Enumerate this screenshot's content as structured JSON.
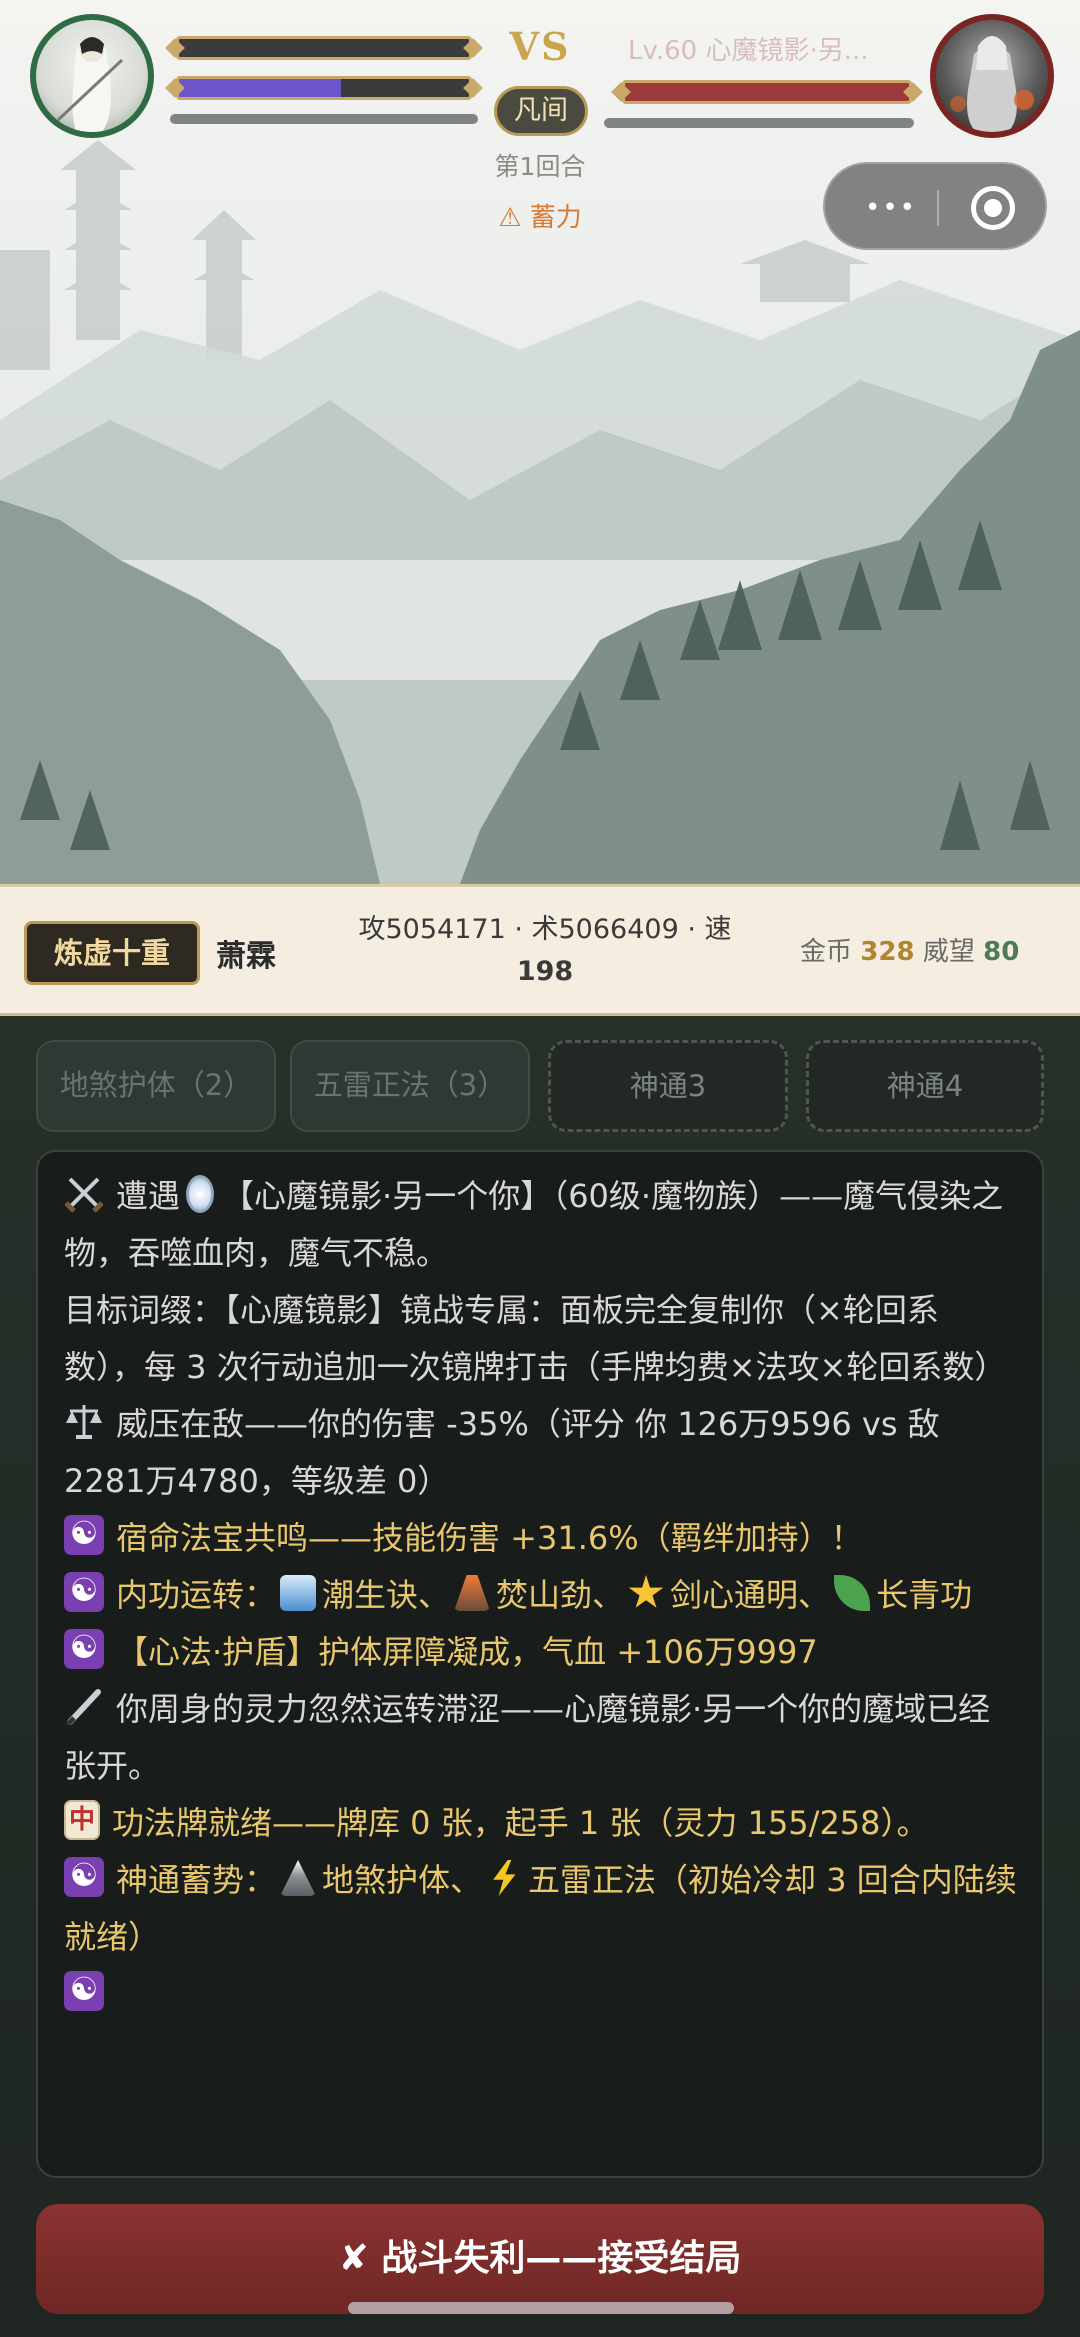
{
  "battle": {
    "vs_label": "VS",
    "realm": "凡间",
    "round": "第1回合",
    "charge_status": "⚠ 蓄力",
    "enemy_name": "Lv.60 心魔镜影·另...",
    "player_mana_fraction": 0.56,
    "enemy_hp_fraction": 1.0
  },
  "capsule": {
    "more": "•••",
    "close_icon": "target-icon"
  },
  "player": {
    "rank": "炼虚十重",
    "name": "萧霖",
    "stats_line1": "攻5054171 · 术5066409 · 速",
    "stats_line2": "198",
    "gold_label": "金币",
    "gold_value": "328",
    "fame_label": "威望",
    "fame_value": "80"
  },
  "skills": [
    {
      "label": "地煞护体（2）",
      "state": "cooldown",
      "icon": "mountain-icon"
    },
    {
      "label": "五雷正法（3）",
      "state": "cooldown",
      "icon": "lightning-icon"
    },
    {
      "label": "神通3",
      "state": "empty"
    },
    {
      "label": "神通4",
      "state": "empty"
    }
  ],
  "log": {
    "l1": "遭遇",
    "l1b": "【心魔镜影·另一个你】（60级·魔物族）——魔气侵染之物，吞噬血肉，魔气不稳。",
    "l2": "目标词缀：【心魔镜影】镜战专属：面板完全复制你（×轮回系数），每 3 次行动追加一次镜牌打击（手牌均费×法攻×轮回系数）",
    "l3": "威压在敌——你的伤害 -35%（评分 你 126万9596 vs 敌 2281万4780，等级差 0）",
    "l4": "宿命法宝共鸣——技能伤害 +31.6%（羁绊加持）！",
    "l5a": "内功运转：",
    "l5b": "潮生诀、",
    "l5c": "焚山劲、",
    "l5d": "剑心通明、",
    "l5e": "长青功",
    "l6": "【心法·护盾】护体屏障凝成，气血 +106万9997",
    "l7": "你周身的灵力忽然运转滞涩——心魔镜影·另一个你的魔域已经张开。",
    "l8": "功法牌就绪——牌库 0 张，起手 1 张（灵力 155/258）。",
    "l9a": "神通蓄势：",
    "l9b": "地煞护体、",
    "l9c": "五雷正法（初始冷却 3 回合内陆续就绪）"
  },
  "footer": {
    "defeat_button": "✘ 战斗失利——接受结局"
  },
  "colors": {
    "accent_gold": "#c9a54e",
    "danger": "#7f2c2a",
    "mana": "#6b55c9",
    "hp_enemy": "#9a3a3a"
  }
}
